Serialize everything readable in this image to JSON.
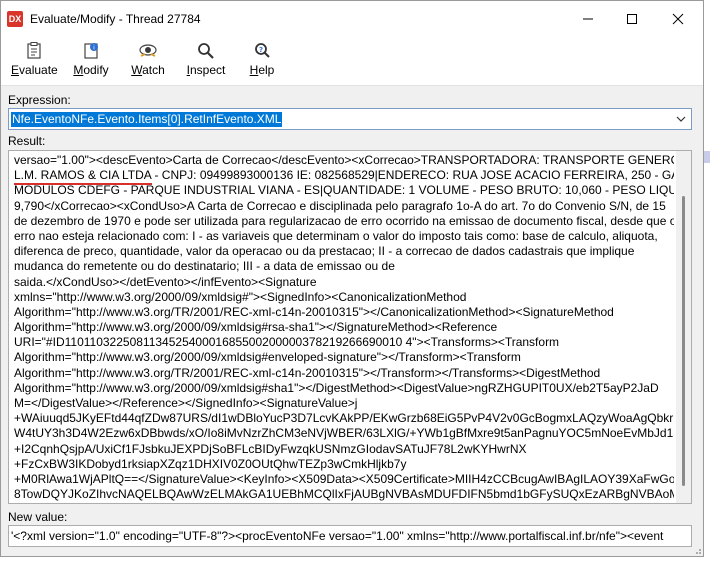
{
  "window": {
    "title": "Evaluate/Modify - Thread 27784",
    "app_icon": "DX",
    "buttons": [
      "minimize-icon",
      "maximize-icon",
      "close-icon"
    ]
  },
  "toolbar": {
    "evaluate": {
      "label": "Evaluate",
      "u": "E",
      "rest": "valuate"
    },
    "modify": {
      "label": "Modify",
      "u": "M",
      "rest": "odify"
    },
    "watch": {
      "label": "Watch",
      "u": "W",
      "rest": "atch"
    },
    "inspect": {
      "label": "Inspect",
      "u": "I",
      "rest": "nspect"
    },
    "help": {
      "label": "Help",
      "u": "H",
      "rest": "elp"
    }
  },
  "expression": {
    "label": "Expression:",
    "value": "Nfe.EventoNFe.Evento.Items[0].RetInfEvento.XML"
  },
  "result": {
    "label": "Result:",
    "lines": [
      "versao=\"1.00\"><descEvento>Carta de Correcao</descEvento><xCorrecao>TRANSPORTADORA: TRANSPORTE GENEROSO -",
      "L.M. RAMOS & CIA LTDA - CNPJ: 09499893000136 IE: 082568529|ENDERECO: RUA JOSE ACACIO FERREIRA, 250 - GALPAO 3 -",
      "MODULOS CDEFG - PARQUE INDUSTRIAL VIANA - ES|QUANTIDADE: 1 VOLUME - PESO BRUTO: 10,060 - PESO LIQUIDO:",
      "9,790</xCorrecao><xCondUso>A Carta de Correcao e disciplinada pelo paragrafo 1o-A do art. 7o do Convenio S/N, de 15",
      "de dezembro de 1970 e pode ser utilizada para regularizacao de erro ocorrido na emissao de documento fiscal, desde que o",
      "erro nao esteja relacionado com: I - as variaveis que determinam o valor do imposto tais como: base de calculo, aliquota,",
      "diferenca de preco, quantidade, valor da operacao ou da prestacao; II - a correcao de dados cadastrais que implique",
      "mudanca do remetente ou do destinatario; III - a data de emissao ou de",
      "saida.</xCondUso></detEvento></infEvento><Signature",
      "xmlns=\"http://www.w3.org/2000/09/xmldsig#\"><SignedInfo><CanonicalizationMethod",
      "Algorithm=\"http://www.w3.org/TR/2001/REC-xml-c14n-20010315\"></CanonicalizationMethod><SignatureMethod",
      "Algorithm=\"http://www.w3.org/2000/09/xmldsig#rsa-sha1\"></SignatureMethod><Reference",
      "URI=\"#ID110110322508113452540001685500200000378219266690010 4\"><Transforms><Transform",
      "Algorithm=\"http://www.w3.org/2000/09/xmldsig#enveloped-signature\"></Transform><Transform",
      "Algorithm=\"http://www.w3.org/TR/2001/REC-xml-c14n-20010315\"></Transform></Transforms><DigestMethod",
      "Algorithm=\"http://www.w3.org/2000/09/xmldsig#sha1\"></DigestMethod><DigestValue>ngRZHGUPIT0UX/eb2T5ayP2JaD",
      "M=</DigestValue></Reference></SignedInfo><SignatureValue>j",
      "+WAiuuqd5JKyEFtd44qfZDw87URS/dI1wDBloYucP3D7LcvKAkPP/EKwGrzb68EiG5PvP4V2v0GcBogmxLAQzyWoaAgQbkrMP0",
      "W4tUY3h3D4W2Ezw6xDBbwds/xO/Io8iMvNzrZhCM3eNVjWBER/63LXlG/+YWb1gBfMxre9t5anPagnuYOC5mNoeEvMbJd1F",
      "+I2CqnhQsjpA/UxiCf1FJsbkuJEXPDjSoBFLcBIDyFwzqkUSNmzGIodavSATuJF78L2wKYHwrNX",
      "+FzCxBW3IKDobyd1rksiapXZqz1DHXIV0Z0OUtQhwTEZp3wCmkHljkb7y",
      "+M0RlAwa1WjAPltQ==</SignatureValue><KeyInfo><X509Data><X509Certificate>MIIH4zCCBcugAwIBAgILAOY39XaFwGox",
      "8TowDQYJKoZIhvcNAQELBQAwWzELMAkGA1UEBhMCQlIxFjAUBgNVBAsMDUFDIFN5bmd1bGFySUQxEzARBgNVBAoMCkID"
    ]
  },
  "new_value": {
    "label": "New value:",
    "value": "'<?xml version=\"1.0\" encoding=\"UTF-8\"?><procEventoNFe versao=\"1.00\" xmlns=\"http://www.portalfiscal.inf.br/nfe\"><event"
  }
}
